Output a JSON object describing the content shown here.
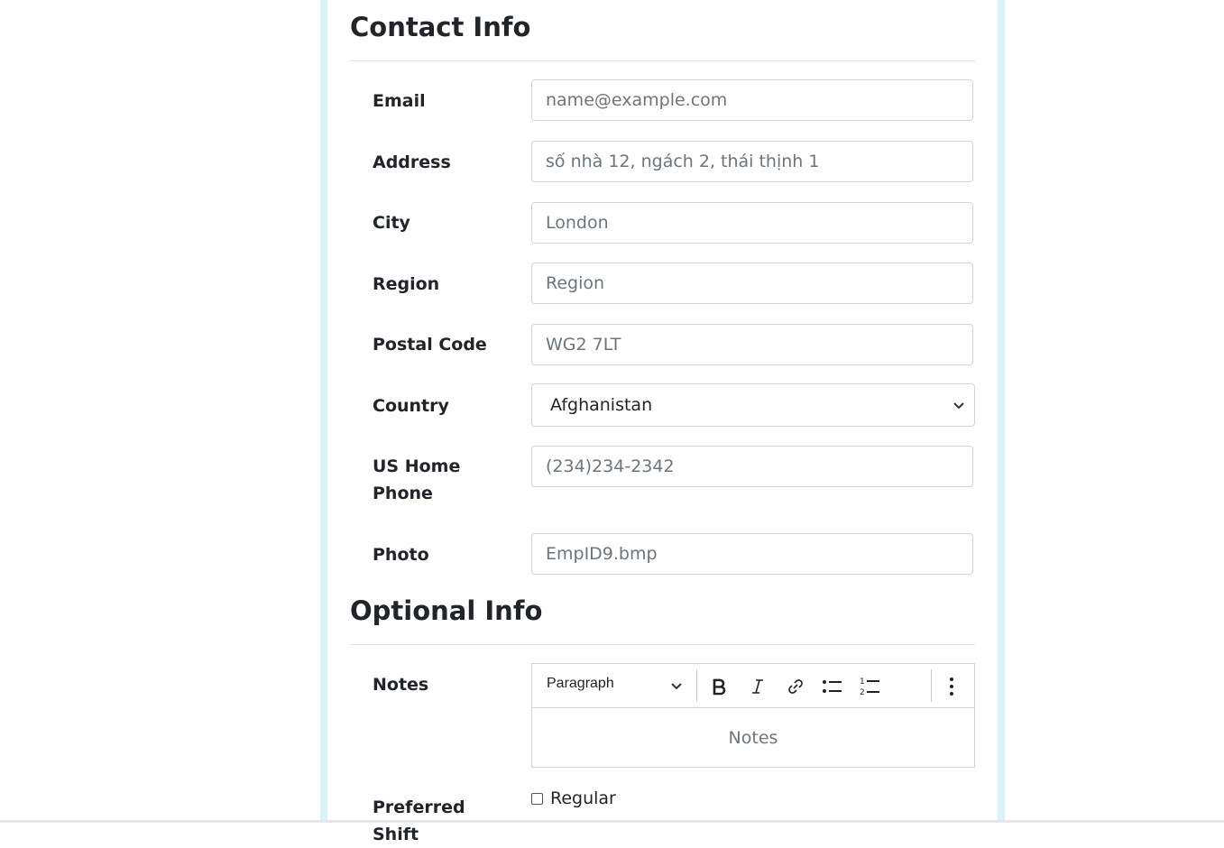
{
  "contact": {
    "title": "Contact Info",
    "email": {
      "label": "Email",
      "placeholder": "name@example.com"
    },
    "address": {
      "label": "Address",
      "placeholder": "số nhà 12, ngách 2, thái thịnh 1"
    },
    "city": {
      "label": "City",
      "placeholder": "London"
    },
    "region": {
      "label": "Region",
      "placeholder": "Region"
    },
    "postal": {
      "label": "Postal Code",
      "placeholder": "WG2 7LT"
    },
    "country": {
      "label": "Country",
      "value": "Afghanistan"
    },
    "phone": {
      "label": "US Home Phone",
      "placeholder": "(234)234-2342"
    },
    "photo": {
      "label": "Photo",
      "placeholder": "EmpID9.bmp"
    }
  },
  "optional": {
    "title": "Optional Info",
    "notes": {
      "label": "Notes",
      "paragraph_style": "Paragraph",
      "placeholder": "Notes",
      "toolbar_icons": [
        "chevron-down-icon",
        "bold-icon",
        "italic-icon",
        "link-icon",
        "bulleted-list-icon",
        "numbered-list-icon",
        "more-vertical-icon"
      ]
    },
    "shift": {
      "label": "Preferred Shift",
      "option": "Regular",
      "checked": false
    }
  }
}
